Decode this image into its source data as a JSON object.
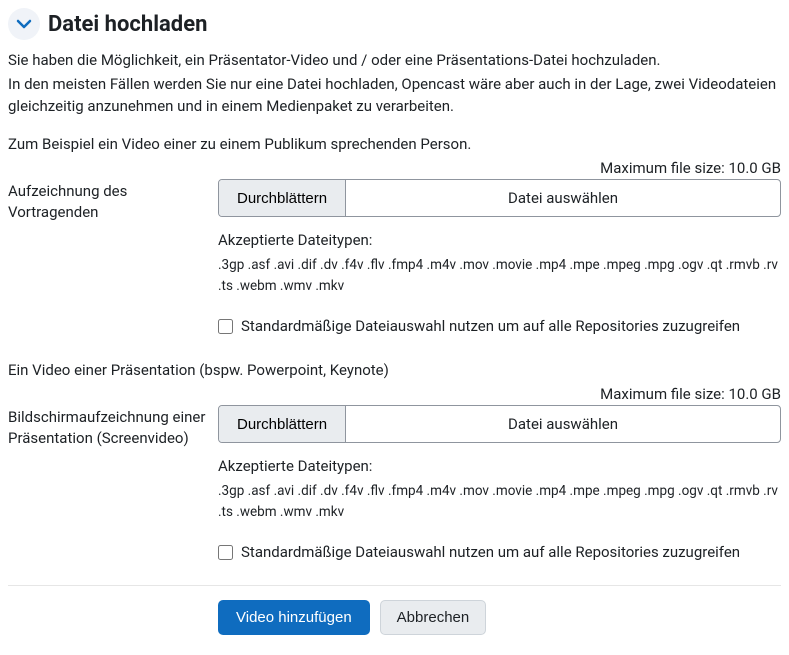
{
  "header": {
    "title": "Datei hochladen"
  },
  "intro": {
    "p1": "Sie haben die Möglichkeit, ein Präsentator-Video und / oder eine Präsentations-Datei hochzuladen.",
    "p2": "In den meisten Fällen werden Sie nur eine Datei hochladen, Opencast wäre aber auch in der Lage, zwei Videodateien gleichzeitig anzunehmen und in einem Medienpaket zu verarbeiten.",
    "example": "Zum Beispiel ein Video einer zu einem Publikum sprechenden Person."
  },
  "max_size_text": "Maximum file size: 10.0 GB",
  "presenter": {
    "label": "Aufzeichnung des Vortragenden",
    "browse": "Durchblättern",
    "file_display": "Datei auswählen",
    "accepted_label": "Akzeptierte Dateitypen:",
    "accepted_list": ".3gp .asf .avi .dif .dv .f4v .flv .fmp4 .m4v .mov .movie .mp4 .mpe .mpeg .mpg .ogv .qt .rmvb .rv .ts .webm .wmv .mkv",
    "checkbox_label": "Standardmäßige Dateiauswahl nutzen um auf alle Repositories zuzugreifen"
  },
  "presentation_heading": "Ein Video einer Präsentation (bspw. Powerpoint, Keynote)",
  "presentation": {
    "label": "Bildschirmaufzeichnung einer Präsentation (Screenvideo)",
    "browse": "Durchblättern",
    "file_display": "Datei auswählen",
    "accepted_label": "Akzeptierte Dateitypen:",
    "accepted_list": ".3gp .asf .avi .dif .dv .f4v .flv .fmp4 .m4v .mov .movie .mp4 .mpe .mpeg .mpg .ogv .qt .rmvb .rv .ts .webm .wmv .mkv",
    "checkbox_label": "Standardmäßige Dateiauswahl nutzen um auf alle Repositories zuzugreifen"
  },
  "actions": {
    "submit": "Video hinzufügen",
    "cancel": "Abbrechen"
  }
}
